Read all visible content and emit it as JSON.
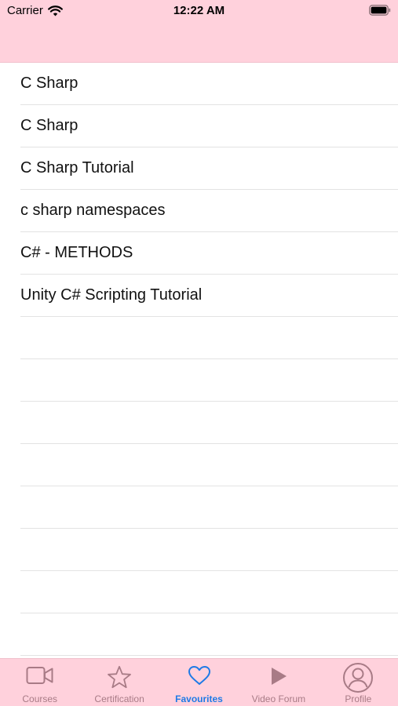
{
  "status_bar": {
    "carrier": "Carrier",
    "time": "12:22 AM"
  },
  "colors": {
    "header_bg": "#ffd1dc",
    "tab_inactive": "#a87b86",
    "tab_active": "#1e7ae6"
  },
  "favourites": {
    "items": [
      {
        "title": "C Sharp"
      },
      {
        "title": "C Sharp"
      },
      {
        "title": "C Sharp Tutorial"
      },
      {
        "title": "c sharp namespaces"
      },
      {
        "title": "C# - METHODS"
      },
      {
        "title": "Unity C# Scripting Tutorial"
      }
    ]
  },
  "tab_bar": {
    "active": "Favourites",
    "tabs": [
      {
        "label": "Courses",
        "icon": "video-camera-icon"
      },
      {
        "label": "Certification",
        "icon": "star-icon"
      },
      {
        "label": "Favourites",
        "icon": "heart-icon"
      },
      {
        "label": "Video Forum",
        "icon": "play-icon"
      },
      {
        "label": "Profile",
        "icon": "profile-icon"
      }
    ]
  }
}
